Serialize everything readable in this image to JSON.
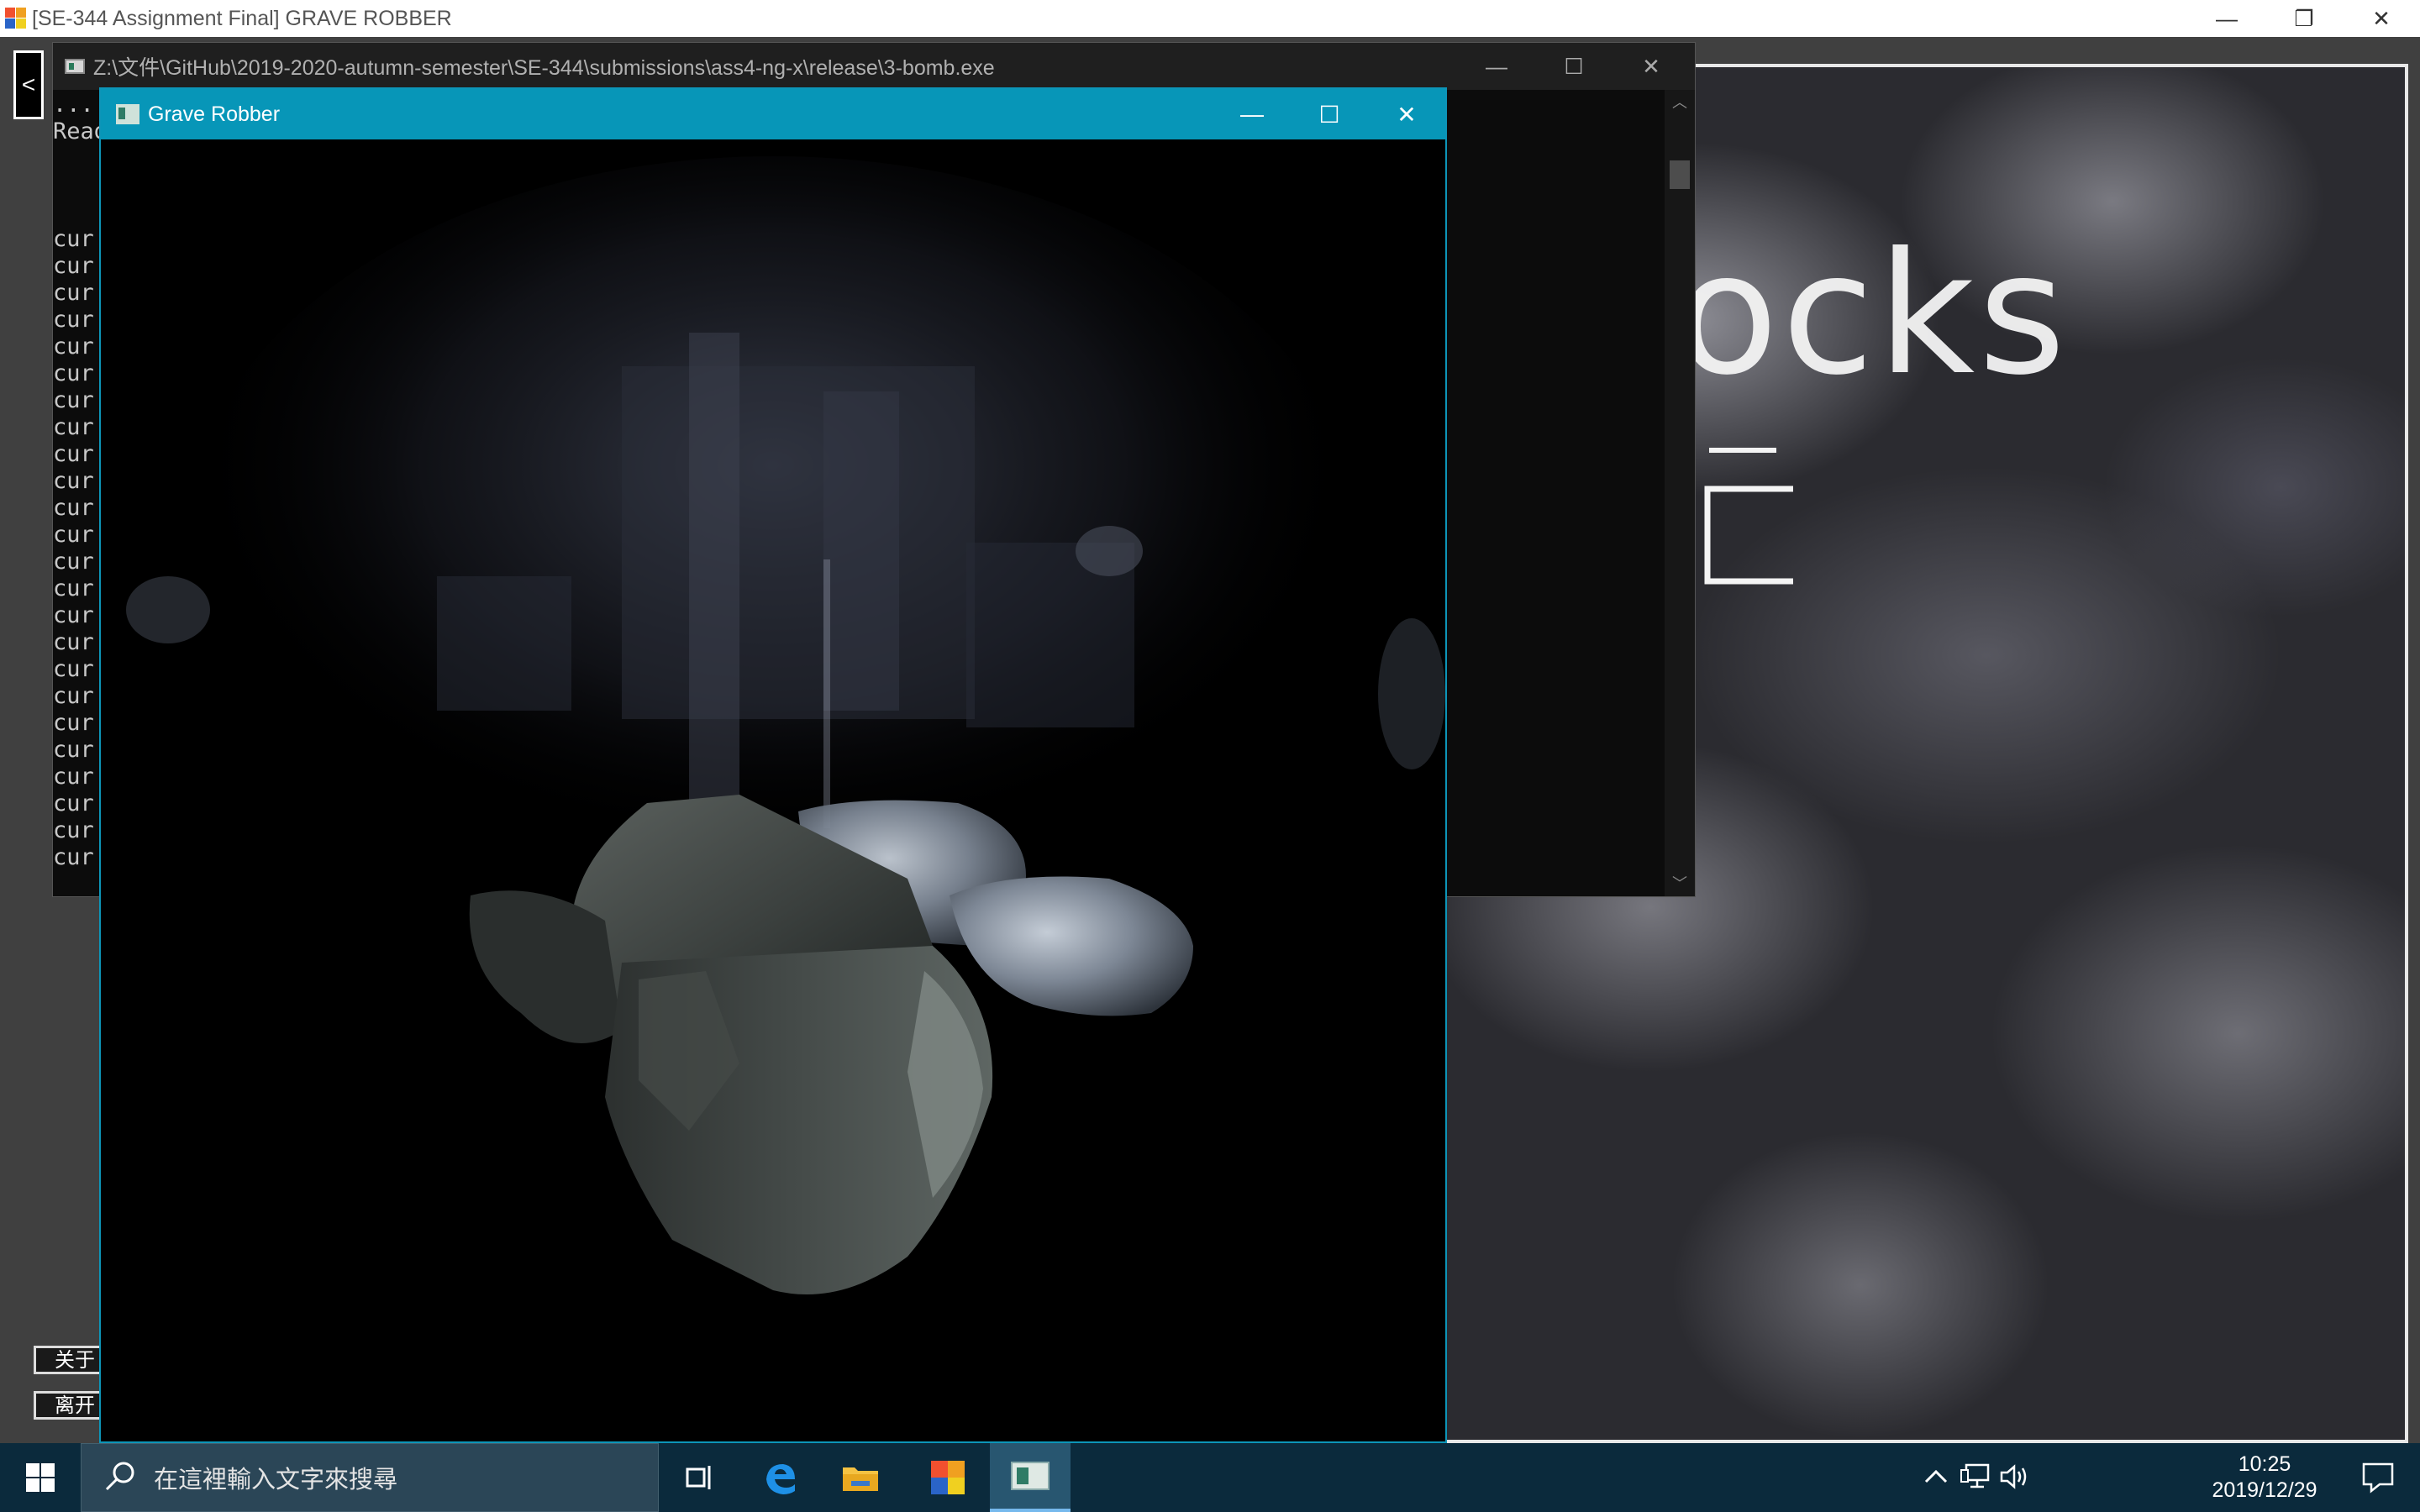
{
  "background_app": {
    "title": "[SE-344 Assignment Final] GRAVE ROBBER",
    "back_label": "<",
    "side_buttons": [
      "关于",
      "离开"
    ],
    "cloud_heading": "ocks",
    "cloud_glyph": "一\n´口"
  },
  "console": {
    "title": "Z:\\文件\\GitHub\\2019-2020-autumn-semester\\SE-344\\submissions\\ass4-ng-x\\release\\3-bomb.exe",
    "lines": [
      "...",
      "Read",
      "",
      "",
      "",
      "cur",
      "cur",
      "cur",
      "cur",
      "cur",
      "cur",
      "cur",
      "cur",
      "cur",
      "cur",
      "cur",
      "cur",
      "cur",
      "cur",
      "cur",
      "cur",
      "cur",
      "cur",
      "cur",
      "cur",
      "cur",
      "cur",
      "cur",
      "cur"
    ]
  },
  "game": {
    "title": "Grave Robber"
  },
  "window_controls": {
    "minimize": "—",
    "maximize": "☐",
    "close": "✕",
    "restore": "❐"
  },
  "taskbar": {
    "search_placeholder": "在這裡輸入文字來搜尋",
    "time": "10:25",
    "date": "2019/12/29",
    "icons": [
      "task-view-icon",
      "edge-icon",
      "file-explorer-icon",
      "launcher-app-icon",
      "grave-robber-app-icon"
    ]
  },
  "colors": {
    "game_titlebar": "#0796b8",
    "taskbar": "#0b2a3c",
    "console_bg": "#0c0c0c"
  }
}
